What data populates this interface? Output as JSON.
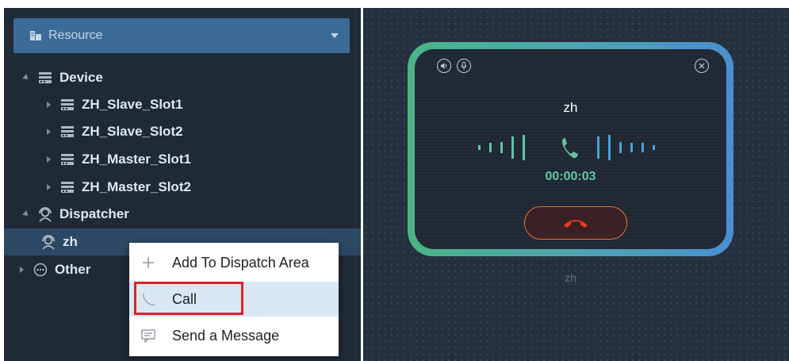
{
  "resource_dropdown": {
    "label": "Resource",
    "icon": "resource-building-icon"
  },
  "tree": {
    "device": {
      "label": "Device",
      "children": [
        "ZH_Slave_Slot1",
        "ZH_Slave_Slot2",
        "ZH_Master_Slot1",
        "ZH_Master_Slot2"
      ]
    },
    "dispatcher": {
      "label": "Dispatcher",
      "children": [
        "zh"
      ]
    },
    "other": {
      "label": "Other"
    }
  },
  "context_menu": {
    "items": [
      {
        "label": "Add To Dispatch Area",
        "icon": "plus-icon"
      },
      {
        "label": "Call",
        "icon": "phone-icon"
      },
      {
        "label": "Send a Message",
        "icon": "message-icon"
      }
    ]
  },
  "call_card": {
    "name": "zh",
    "timer": "00:00:03",
    "label_below": "zh",
    "colors": {
      "gradient_start": "#4bb486",
      "gradient_end": "#4a8fd1",
      "hangup": "#e33d2a"
    }
  }
}
